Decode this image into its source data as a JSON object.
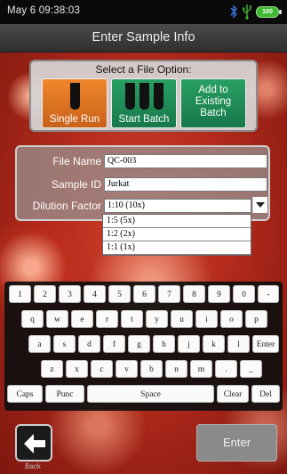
{
  "status_bar": {
    "datetime": "May 6 09:38:03",
    "battery_label": "100",
    "icons": [
      "bluetooth-icon",
      "usb-icon",
      "battery-icon"
    ]
  },
  "header": {
    "title": "Enter Sample Info"
  },
  "file_option": {
    "heading": "Select a File Option:",
    "options": [
      {
        "label": "Single Run",
        "icon": "tube-icon",
        "color": "#e97a26"
      },
      {
        "label": "Start Batch",
        "icon": "tubes-icon",
        "color": "#1f8f57"
      },
      {
        "label": "Add to\nExisting\nBatch",
        "icon": "",
        "color": "#1f8f57"
      }
    ]
  },
  "form": {
    "file_name": {
      "label": "File Name",
      "value": "QC-003"
    },
    "sample_id": {
      "label": "Sample ID",
      "value": "Jurkat"
    },
    "dilution_factor": {
      "label": "Dilution Factor",
      "value": "1:10 (10x)",
      "options": [
        "1:5 (5x)",
        "1:2 (2x)",
        "1:1 (1x)"
      ]
    }
  },
  "keyboard": {
    "rows": [
      [
        "1",
        "2",
        "3",
        "4",
        "5",
        "6",
        "7",
        "8",
        "9",
        "0",
        "-"
      ],
      [
        "q",
        "w",
        "e",
        "r",
        "t",
        "y",
        "u",
        "i",
        "o",
        "p"
      ],
      [
        "a",
        "s",
        "d",
        "f",
        "g",
        "h",
        "j",
        "k",
        "l",
        "Enter"
      ],
      [
        "z",
        "x",
        "c",
        "v",
        "b",
        "n",
        "m",
        ".",
        "_"
      ],
      [
        "Caps",
        "Punc",
        "Space",
        "Clear",
        "Del"
      ]
    ]
  },
  "footer": {
    "back_label": "Back",
    "enter_label": "Enter"
  },
  "colors": {
    "background": "#b22a1b",
    "single_run": "#e97a26",
    "batch": "#1f8f57",
    "battery": "#3fb92f",
    "bluetooth": "#3a6fd8",
    "usb": "#3fb92f"
  }
}
